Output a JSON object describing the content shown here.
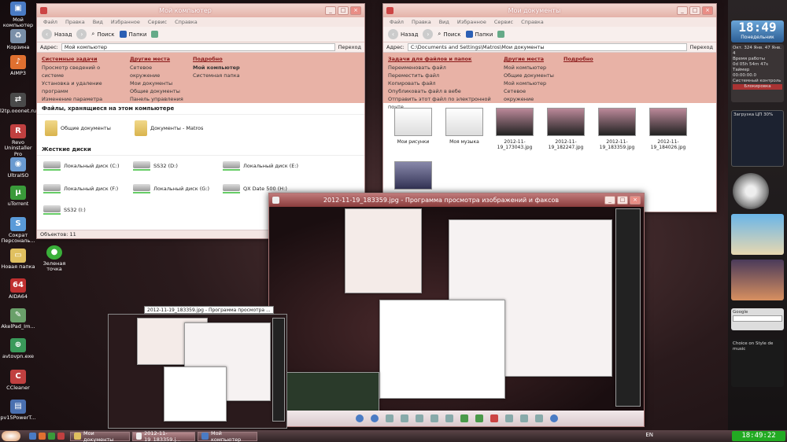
{
  "desktop": {
    "icons": [
      {
        "label": "Мой компьютер",
        "color": "#4a7bc4"
      },
      {
        "label": "Корзина",
        "color": "#7a8fa8"
      },
      {
        "label": "AIMP3",
        "color": "#e07030"
      },
      {
        "label": "l2tp.ooonet.ru",
        "color": "#4a4a4a"
      },
      {
        "label": "Revo Uninstaller Pro",
        "color": "#c04040"
      },
      {
        "label": "UltraISO",
        "color": "#6a9ad0"
      },
      {
        "label": "uTorrent",
        "color": "#3a9a3a"
      },
      {
        "label": "Сократ Персональ...",
        "color": "#5a9ad8"
      },
      {
        "label": "Новая папка",
        "color": "#e0c060"
      },
      {
        "label": "AIDA64",
        "color": "#c03030"
      },
      {
        "label": "AkelPad_Im...",
        "color": "#6aa06a"
      },
      {
        "label": "avtovpn.exe",
        "color": "#3a9a5a"
      },
      {
        "label": "CCleaner",
        "color": "#c04040"
      },
      {
        "label": "pv15PowerT...",
        "color": "#4a70b0"
      },
      {
        "label": "Зеленая точка",
        "color": "#3ab03a"
      }
    ]
  },
  "win_computer": {
    "title": "Мой компьютер",
    "menu": [
      "Файл",
      "Правка",
      "Вид",
      "Избранное",
      "Сервис",
      "Справка"
    ],
    "back": "Назад",
    "search": "Поиск",
    "folders": "Папки",
    "address_label": "Адрес:",
    "address": "Мой компьютер",
    "go": "Переход",
    "tasks": {
      "system_title": "Системные задачи",
      "system_items": [
        "Просмотр сведений о системе",
        "Установка и удаление программ",
        "Изменение параметра"
      ],
      "other_title": "Другие места",
      "other_items": [
        "Сетевое окружение",
        "Мои документы",
        "Общие документы",
        "Панель управления"
      ],
      "details_title": "Подробно",
      "details_items": [
        "Мой компьютер",
        "Системная папка"
      ]
    },
    "files_header": "Файлы, хранящиеся на этом компьютере",
    "shared_docs": "Общие документы",
    "matros_docs": "Документы - Matros",
    "disks_header": "Жесткие диски",
    "drives": [
      "Локальный диск (C:)",
      "SS32 (D:)",
      "Локальный диск (E:)",
      "Локальный диск (F:)",
      "Локальный диск (G:)",
      "QX Date 500 (H:)",
      "SS32 (I:)"
    ],
    "status": "Объектов: 11"
  },
  "win_docs": {
    "title": "Мои документы",
    "back": "Назад",
    "search": "Поиск",
    "folders": "Папки",
    "address_label": "Адрес:",
    "address": "C:\\Documents and Settings\\Matros\\Мои документы",
    "go": "Переход",
    "tasks": {
      "files_title": "Задачи для файлов и папок",
      "files_items": [
        "Переименовать файл",
        "Переместить файл",
        "Копировать файл",
        "Опубликовать файл в вебе",
        "Отправить этот файл по электронной почте"
      ],
      "other_title": "Другие места",
      "other_items": [
        "Мой компьютер",
        "Общие документы",
        "Мой компьютер",
        "Сетевое окружение"
      ],
      "details_title": "Подробно"
    },
    "thumbs": [
      "Мои рисунки",
      "Моя музыка",
      "2012-11-19_173043.jpg",
      "2012-11-19_182247.jpg",
      "2012-11-19_183359.jpg",
      "2012-11-19_184026.jpg"
    ]
  },
  "viewer": {
    "title": "2012-11-19_183359.jpg - Программа просмотра изображений и факсов"
  },
  "preview": {
    "title": "2012-11-19_183359.jpg - Программа просмотра ..."
  },
  "gadgets": {
    "clock_time": "18:49",
    "clock_day": "Понедельник",
    "clock_date": "Окт. 324 Янв. 47 Янв. 4",
    "uptime_title": "Время работы",
    "uptime": "0d 05h 54m 47s",
    "timer_label": "Таймер",
    "timer": "00:00:00.0",
    "sys_control": "Системный контроль",
    "block": "Блокировка",
    "cpu_title": "Загрузка ЦП",
    "cpu_pct": "30%",
    "google": "Google",
    "choice": "Choice on Style de music"
  },
  "taskbar": {
    "items": [
      "Мои документы",
      "2012-11-19_183359.j...",
      "Мой компьютер"
    ],
    "lang": "EN",
    "clock": "18:49:22"
  }
}
